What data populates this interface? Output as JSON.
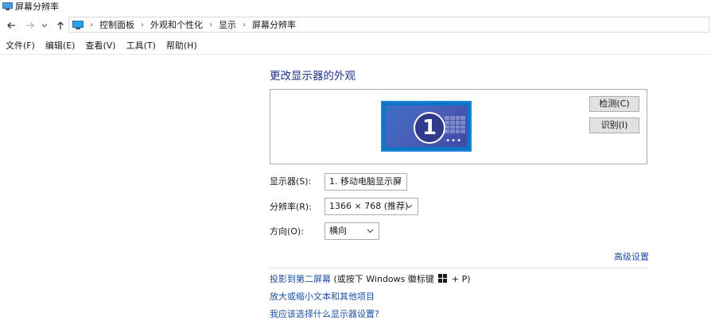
{
  "window": {
    "title": "屏幕分辨率"
  },
  "nav": {
    "breadcrumbs": [
      "控制面板",
      "外观和个性化",
      "显示",
      "屏幕分辨率"
    ]
  },
  "menu": [
    "文件(F)",
    "编辑(E)",
    "查看(V)",
    "工具(T)",
    "帮助(H)"
  ],
  "main": {
    "heading": "更改显示器的外观",
    "monitor_number": "1",
    "detect_button": "检测(C)",
    "identify_button": "识别(I)",
    "display_label": "显示器(S):",
    "display_value": "1. 移动电脑显示屏",
    "resolution_label": "分辨率(R):",
    "resolution_value": "1366 × 768 (推荐)",
    "orientation_label": "方向(O):",
    "orientation_value": "横向",
    "advanced_link": "高级设置",
    "project_link": "投影到第二屏幕",
    "project_hint_prefix": "(或按下 Windows 徽标键",
    "project_hint_suffix": "+ P)",
    "text_size_link": "放大或缩小文本和其他项目",
    "which_settings_link": "我应该选择什么显示器设置?"
  },
  "colors": {
    "heading": "#1e3287",
    "link": "#1e50a0",
    "monitor_fill": "#0f73c6"
  },
  "icons": {
    "title": "monitor-icon",
    "back": "back-arrow-icon",
    "forward": "forward-arrow-icon",
    "history": "chevron-down-icon",
    "up": "up-arrow-icon",
    "address": "monitor-icon",
    "windows_logo": "windows-logo-icon"
  }
}
